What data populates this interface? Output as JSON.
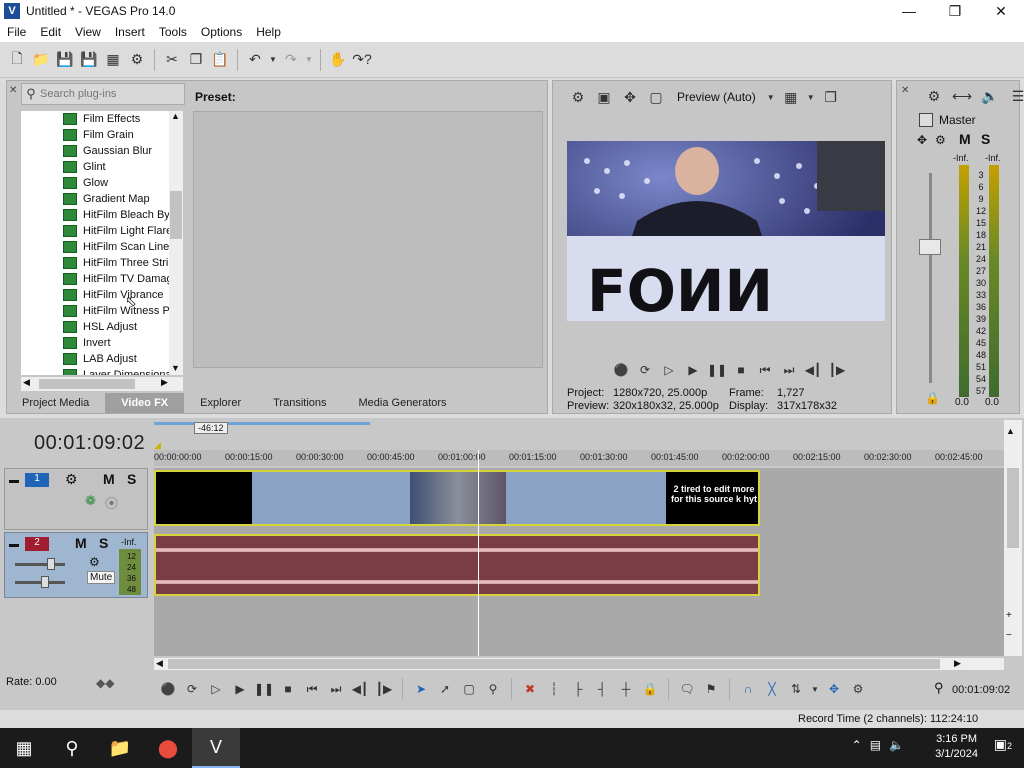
{
  "window": {
    "title": "Untitled * - VEGAS Pro 14.0",
    "app_icon": "V"
  },
  "menu": [
    "File",
    "Edit",
    "View",
    "Insert",
    "Tools",
    "Options",
    "Help"
  ],
  "fx": {
    "search_placeholder": "Search plug-ins",
    "preset_label": "Preset:",
    "items": [
      "Film Effects",
      "Film Grain",
      "Gaussian Blur",
      "Glint",
      "Glow",
      "Gradient Map",
      "HitFilm Bleach Byp",
      "HitFilm Light Flares",
      "HitFilm Scan Lines",
      "HitFilm Three Strip",
      "HitFilm TV Damage",
      "HitFilm Vibrance",
      "HitFilm Witness Pr",
      "HSL Adjust",
      "Invert",
      "LAB Adjust",
      "Layer Dimensional"
    ]
  },
  "tabs": [
    "Project Media",
    "Video FX",
    "Explorer",
    "Transitions",
    "Media Generators"
  ],
  "active_tab": "Video FX",
  "preview": {
    "quality": "Preview (Auto)",
    "project_label": "Project:",
    "project_value": "1280x720, 25.000p",
    "preview_label": "Preview:",
    "preview_value": "320x180x32, 25.000p",
    "frame_label": "Frame:",
    "frame_value": "1,727",
    "display_label": "Display:",
    "display_value": "317x178x32",
    "video_text": "FOИИ"
  },
  "master": {
    "label": "Master",
    "m": "M",
    "s": "S",
    "inf_left": "-Inf.",
    "inf_right": "-Inf.",
    "scale": [
      "3",
      "6",
      "9",
      "12",
      "15",
      "18",
      "21",
      "24",
      "27",
      "30",
      "33",
      "36",
      "39",
      "42",
      "45",
      "48",
      "51",
      "54",
      "57"
    ],
    "val_left": "0.0",
    "val_right": "0.0"
  },
  "timeline": {
    "timecode": "00:01:09:02",
    "marker": "-46:12",
    "ticks": [
      "00:00:00:00",
      "00:00:15:00",
      "00:00:30:00",
      "00:00:45:00",
      "00:01:00:00",
      "00:01:15:00",
      "00:01:30:00",
      "00:01:45:00",
      "00:02:00:00",
      "00:02:15:00",
      "00:02:30:00",
      "00:02:45:00"
    ],
    "track1": {
      "number": "1",
      "m": "M",
      "s": "S"
    },
    "track2": {
      "number": "2",
      "m": "M",
      "s": "S",
      "tooltip": "Mute",
      "inf": "-Inf.",
      "scale": [
        "12",
        "24",
        "36",
        "48"
      ]
    },
    "clip_caption": "2 tired to edit more for this source k hyt",
    "rate": "Rate: 0.00",
    "end_time": "00:01:09:02"
  },
  "status": {
    "record_time": "Record Time (2 channels): 112:24:10"
  },
  "taskbar": {
    "time": "3:16 PM",
    "date": "3/1/2024",
    "notifications": "2"
  }
}
